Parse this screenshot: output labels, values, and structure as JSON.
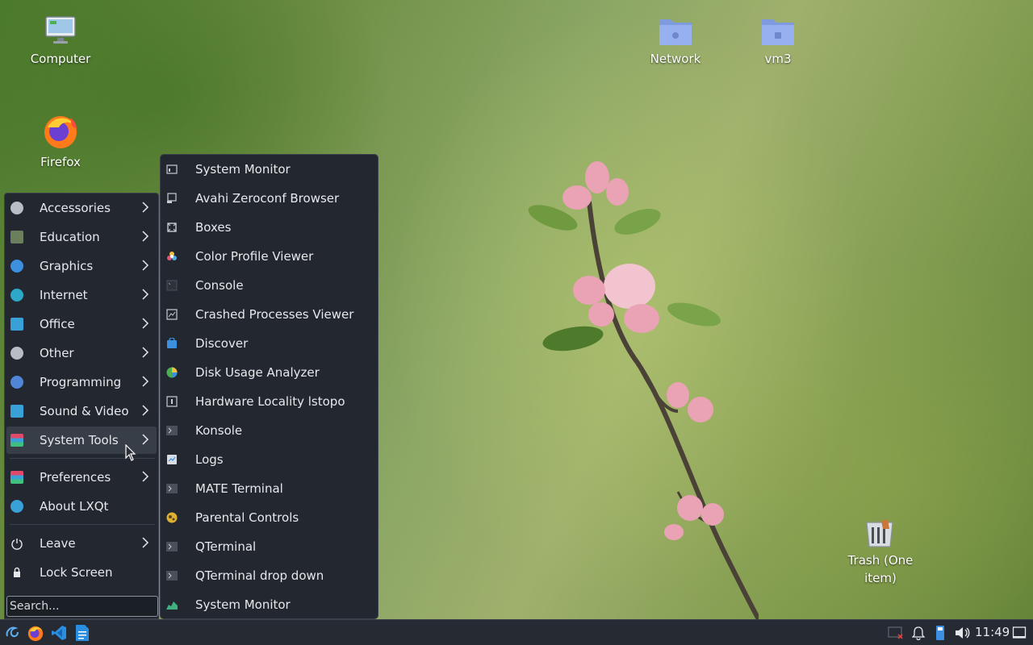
{
  "desktop": {
    "icons": [
      {
        "label": "Computer"
      },
      {
        "label": "Firefox"
      },
      {
        "label": "Network"
      },
      {
        "label": "vm3"
      },
      {
        "label": "Trash (One item)"
      }
    ]
  },
  "main_menu": {
    "items": [
      {
        "label": "Accessories",
        "icon": "accessories-icon"
      },
      {
        "label": "Education",
        "icon": "education-icon"
      },
      {
        "label": "Graphics",
        "icon": "graphics-icon"
      },
      {
        "label": "Internet",
        "icon": "internet-icon"
      },
      {
        "label": "Office",
        "icon": "office-icon"
      },
      {
        "label": "Other",
        "icon": "other-icon"
      },
      {
        "label": "Programming",
        "icon": "programming-icon"
      },
      {
        "label": "Sound & Video",
        "icon": "sound-video-icon"
      },
      {
        "label": "System Tools",
        "icon": "system-tools-icon",
        "active": true
      }
    ],
    "extra": [
      {
        "label": "Preferences"
      },
      {
        "label": "About LXQt"
      }
    ],
    "session": [
      {
        "label": "Leave"
      },
      {
        "label": "Lock Screen"
      }
    ],
    "search_placeholder": "Search..."
  },
  "submenu": {
    "items": [
      {
        "label": "System Monitor"
      },
      {
        "label": "Avahi Zeroconf Browser"
      },
      {
        "label": "Boxes"
      },
      {
        "label": "Color Profile Viewer"
      },
      {
        "label": "Console"
      },
      {
        "label": "Crashed Processes Viewer"
      },
      {
        "label": "Discover"
      },
      {
        "label": "Disk Usage Analyzer"
      },
      {
        "label": "Hardware Locality lstopo"
      },
      {
        "label": "Konsole"
      },
      {
        "label": "Logs"
      },
      {
        "label": "MATE Terminal"
      },
      {
        "label": "Parental Controls"
      },
      {
        "label": "QTerminal"
      },
      {
        "label": "QTerminal drop down"
      },
      {
        "label": "System Monitor"
      }
    ]
  },
  "taskbar": {
    "clock": "11:49"
  },
  "colors": {
    "menu_bg": "#232830",
    "menu_active": "#373e48",
    "text": "#e6e8eb",
    "folder_blue": "#8fa9e8"
  }
}
